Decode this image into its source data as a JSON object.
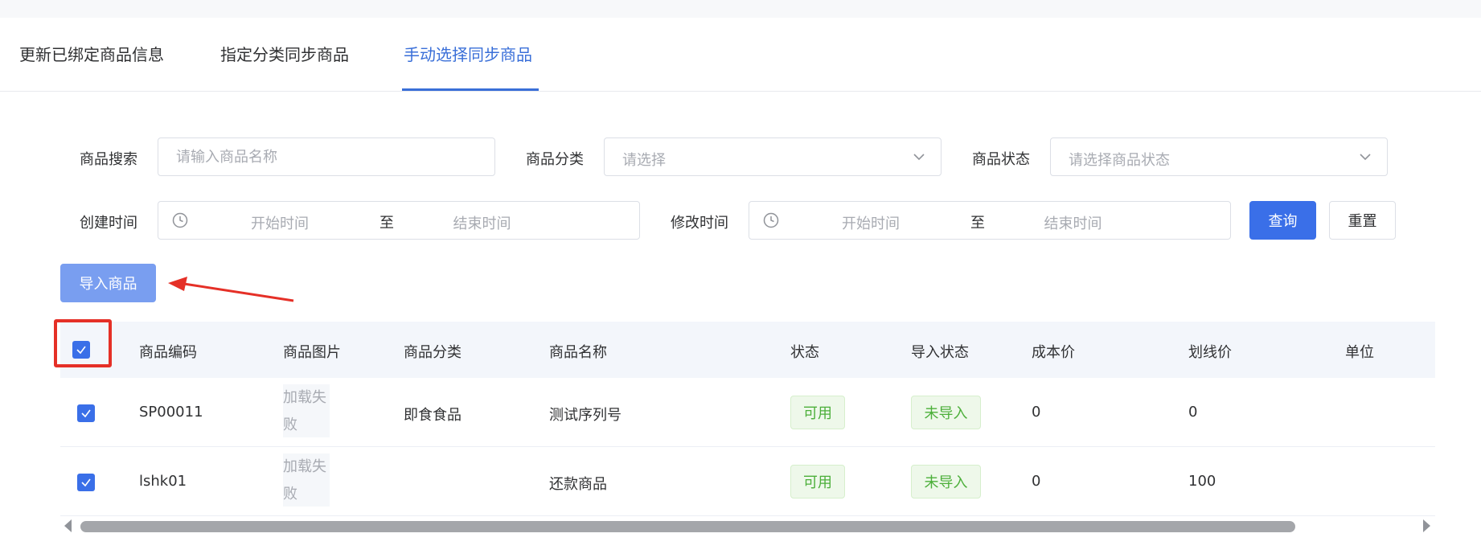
{
  "tabs": [
    {
      "label": "更新已绑定商品信息"
    },
    {
      "label": "指定分类同步商品"
    },
    {
      "label": "手动选择同步商品"
    }
  ],
  "active_tab_index": 2,
  "filters": {
    "search": {
      "label": "商品搜索",
      "placeholder": "请输入商品名称"
    },
    "category": {
      "label": "商品分类",
      "placeholder": "请选择"
    },
    "status": {
      "label": "商品状态",
      "placeholder": "请选择商品状态"
    },
    "created": {
      "label": "创建时间",
      "start": "开始时间",
      "separator": "至",
      "end": "结束时间"
    },
    "modified": {
      "label": "修改时间",
      "start": "开始时间",
      "separator": "至",
      "end": "结束时间"
    }
  },
  "buttons": {
    "query": "查询",
    "reset": "重置",
    "import": "导入商品"
  },
  "table": {
    "headers": [
      "商品编码",
      "商品图片",
      "商品分类",
      "商品名称",
      "状态",
      "导入状态",
      "成本价",
      "划线价",
      "单位"
    ],
    "header_checked": true,
    "rows": [
      {
        "checked": true,
        "code": "SP00011",
        "image": "加载失败",
        "category": "即食食品",
        "name": "测试序列号",
        "status": "可用",
        "import_status": "未导入",
        "cost": "0",
        "list_price": "0",
        "unit": ""
      },
      {
        "checked": true,
        "code": "lshk01",
        "image": "加载失败",
        "category": "",
        "name": "还款商品",
        "status": "可用",
        "import_status": "未导入",
        "cost": "0",
        "list_price": "100",
        "unit": ""
      }
    ]
  },
  "scrollbar": {
    "thumb_fraction": 0.91
  },
  "colors": {
    "accent": "#3a6fe8",
    "annotation": "#e53027",
    "tag_green": "#4caf3a"
  }
}
